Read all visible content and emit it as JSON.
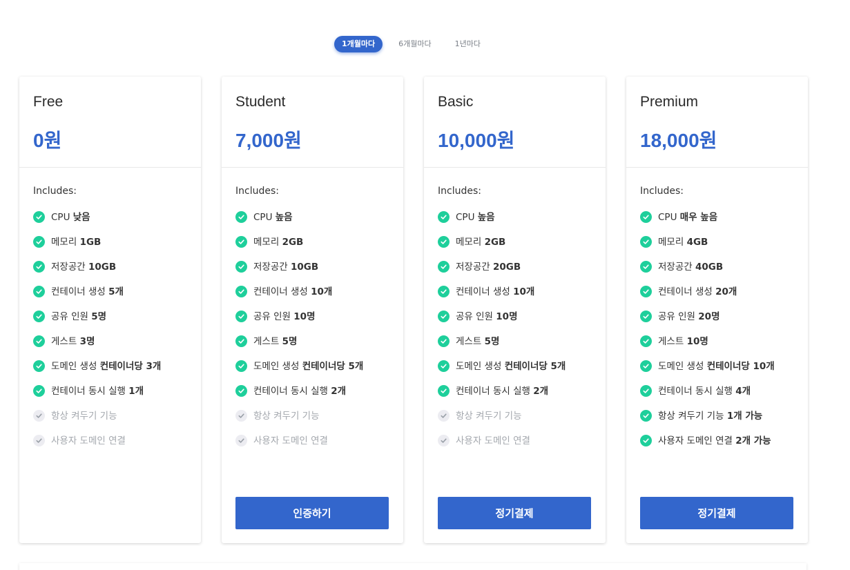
{
  "colors": {
    "accent": "#3366cc",
    "check": "#1ecf9b",
    "check_disabled": "#ececf1"
  },
  "period_tabs": [
    {
      "label": "1개월마다",
      "active": true
    },
    {
      "label": "6개월마다",
      "active": false
    },
    {
      "label": "1년마다",
      "active": false
    }
  ],
  "icons": {
    "enabled": "check-circle-icon",
    "disabled": "check-circle-disabled-icon"
  },
  "plans": [
    {
      "name": "Free",
      "price": "0원",
      "includes_label": "Includes:",
      "features": [
        {
          "text": "CPU",
          "value": "낮음",
          "enabled": true
        },
        {
          "text": "메모리",
          "value": "1GB",
          "enabled": true
        },
        {
          "text": "저장공간",
          "value": "10GB",
          "enabled": true
        },
        {
          "text": "컨테이너 생성",
          "value": "5개",
          "enabled": true
        },
        {
          "text": "공유 인원",
          "value": "5명",
          "enabled": true
        },
        {
          "text": "게스트",
          "value": "3명",
          "enabled": true
        },
        {
          "text": "도메인 생성",
          "value": "컨테이너당 3개",
          "enabled": true
        },
        {
          "text": "컨테이너 동시 실행",
          "value": "1개",
          "enabled": true
        },
        {
          "text": "항상 켜두기 기능",
          "value": "",
          "enabled": false
        },
        {
          "text": "사용자 도메인 연결",
          "value": "",
          "enabled": false
        }
      ],
      "button": null
    },
    {
      "name": "Student",
      "price": "7,000원",
      "includes_label": "Includes:",
      "features": [
        {
          "text": "CPU",
          "value": "높음",
          "enabled": true
        },
        {
          "text": "메모리",
          "value": "2GB",
          "enabled": true
        },
        {
          "text": "저장공간",
          "value": "10GB",
          "enabled": true
        },
        {
          "text": "컨테이너 생성",
          "value": "10개",
          "enabled": true
        },
        {
          "text": "공유 인원",
          "value": "10명",
          "enabled": true
        },
        {
          "text": "게스트",
          "value": "5명",
          "enabled": true
        },
        {
          "text": "도메인 생성",
          "value": "컨테이너당 5개",
          "enabled": true
        },
        {
          "text": "컨테이너 동시 실행",
          "value": "2개",
          "enabled": true
        },
        {
          "text": "항상 켜두기 기능",
          "value": "",
          "enabled": false
        },
        {
          "text": "사용자 도메인 연결",
          "value": "",
          "enabled": false
        }
      ],
      "button": "인증하기"
    },
    {
      "name": "Basic",
      "price": "10,000원",
      "includes_label": "Includes:",
      "features": [
        {
          "text": "CPU",
          "value": "높음",
          "enabled": true
        },
        {
          "text": "메모리",
          "value": "2GB",
          "enabled": true
        },
        {
          "text": "저장공간",
          "value": "20GB",
          "enabled": true
        },
        {
          "text": "컨테이너 생성",
          "value": "10개",
          "enabled": true
        },
        {
          "text": "공유 인원",
          "value": "10명",
          "enabled": true
        },
        {
          "text": "게스트",
          "value": "5명",
          "enabled": true
        },
        {
          "text": "도메인 생성",
          "value": "컨테이너당 5개",
          "enabled": true
        },
        {
          "text": "컨테이너 동시 실행",
          "value": "2개",
          "enabled": true
        },
        {
          "text": "항상 켜두기 기능",
          "value": "",
          "enabled": false
        },
        {
          "text": "사용자 도메인 연결",
          "value": "",
          "enabled": false
        }
      ],
      "button": "정기결제"
    },
    {
      "name": "Premium",
      "price": "18,000원",
      "includes_label": "Includes:",
      "features": [
        {
          "text": "CPU",
          "value": "매우 높음",
          "enabled": true
        },
        {
          "text": "메모리",
          "value": "4GB",
          "enabled": true
        },
        {
          "text": "저장공간",
          "value": "40GB",
          "enabled": true
        },
        {
          "text": "컨테이너 생성",
          "value": "20개",
          "enabled": true
        },
        {
          "text": "공유 인원",
          "value": "20명",
          "enabled": true
        },
        {
          "text": "게스트",
          "value": "10명",
          "enabled": true
        },
        {
          "text": "도메인 생성",
          "value": "컨테이너당 10개",
          "enabled": true
        },
        {
          "text": "컨테이너 동시 실행",
          "value": "4개",
          "enabled": true
        },
        {
          "text": "항상 켜두기 기능",
          "value": "1개 가능",
          "enabled": true
        },
        {
          "text": "사용자 도메인 연결",
          "value": "2개 가능",
          "enabled": true
        }
      ],
      "button": "정기결제"
    }
  ]
}
